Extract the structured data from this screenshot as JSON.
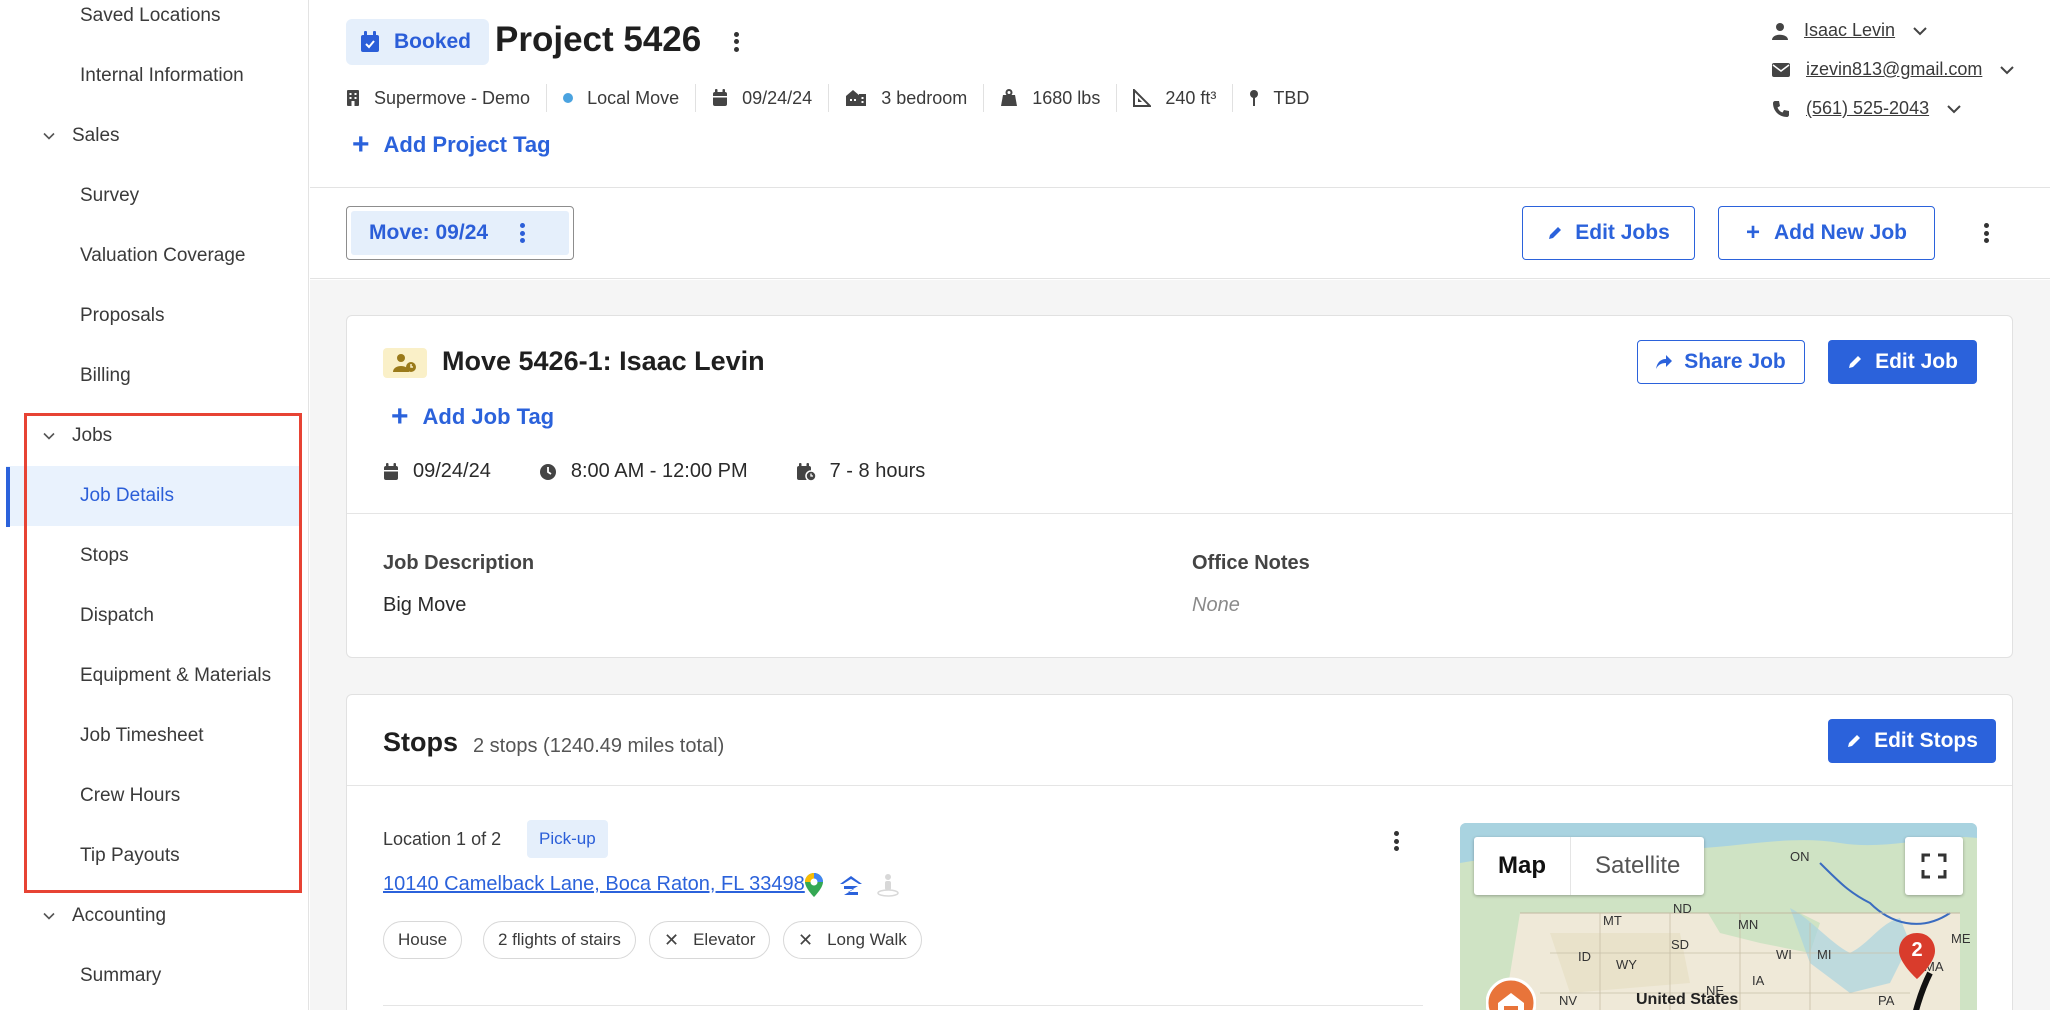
{
  "sidebar": {
    "items_top": [
      {
        "label": "Saved Locations"
      },
      {
        "label": "Internal Information"
      }
    ],
    "sales": {
      "label": "Sales",
      "items": [
        {
          "label": "Survey"
        },
        {
          "label": "Valuation Coverage"
        },
        {
          "label": "Proposals"
        },
        {
          "label": "Billing"
        }
      ]
    },
    "jobs": {
      "label": "Jobs",
      "items": [
        {
          "label": "Job Details"
        },
        {
          "label": "Stops"
        },
        {
          "label": "Dispatch"
        },
        {
          "label": "Equipment & Materials"
        },
        {
          "label": "Job Timesheet"
        },
        {
          "label": "Crew Hours"
        },
        {
          "label": "Tip Payouts"
        }
      ]
    },
    "accounting": {
      "label": "Accounting",
      "items": [
        {
          "label": "Summary"
        }
      ]
    }
  },
  "header": {
    "status": "Booked",
    "title": "Project 5426",
    "meta": {
      "company": "Supermove - Demo",
      "move_type": "Local Move",
      "date": "09/24/24",
      "size": "3 bedroom",
      "weight": "1680 lbs",
      "volume": "240 ft³",
      "location": "TBD"
    },
    "add_project_tag": "Add Project Tag",
    "contact": {
      "name": "Isaac Levin",
      "email": "izevin813@gmail.com",
      "phone": "(561) 525-2043"
    }
  },
  "movebar": {
    "tab": "Move: 09/24",
    "edit_jobs": "Edit Jobs",
    "add_new_job": "Add New Job"
  },
  "job": {
    "title": "Move 5426-1: Isaac Levin",
    "share_job": "Share Job",
    "edit_job": "Edit Job",
    "add_job_tag": "Add Job Tag",
    "date": "09/24/24",
    "time": "8:00 AM - 12:00 PM",
    "duration": "7 - 8 hours",
    "description_label": "Job Description",
    "description": "Big Move",
    "office_notes_label": "Office Notes",
    "office_notes": "None"
  },
  "stops": {
    "title": "Stops",
    "summary": "2 stops (1240.49 miles total)",
    "edit_stops": "Edit Stops",
    "location_label": "Location 1 of 2",
    "location_type": "Pick-up",
    "address": "10140 Camelback Lane, Boca Raton, FL 33498",
    "chips": [
      "House",
      "2 flights of stairs",
      "Elevator",
      "Long Walk"
    ],
    "map": {
      "map_label": "Map",
      "satellite_label": "Satellite",
      "marker": "2",
      "country_label": "United States",
      "region_labels": [
        "ON",
        "ND",
        "MN",
        "MT",
        "SD",
        "WI",
        "MI",
        "ID",
        "WY",
        "IA",
        "NV",
        "PA",
        "MA",
        "ME",
        "NE"
      ]
    }
  },
  "colors": {
    "accent": "#2b62db",
    "highlight": "#e74334",
    "status_bg": "#e5effb"
  }
}
